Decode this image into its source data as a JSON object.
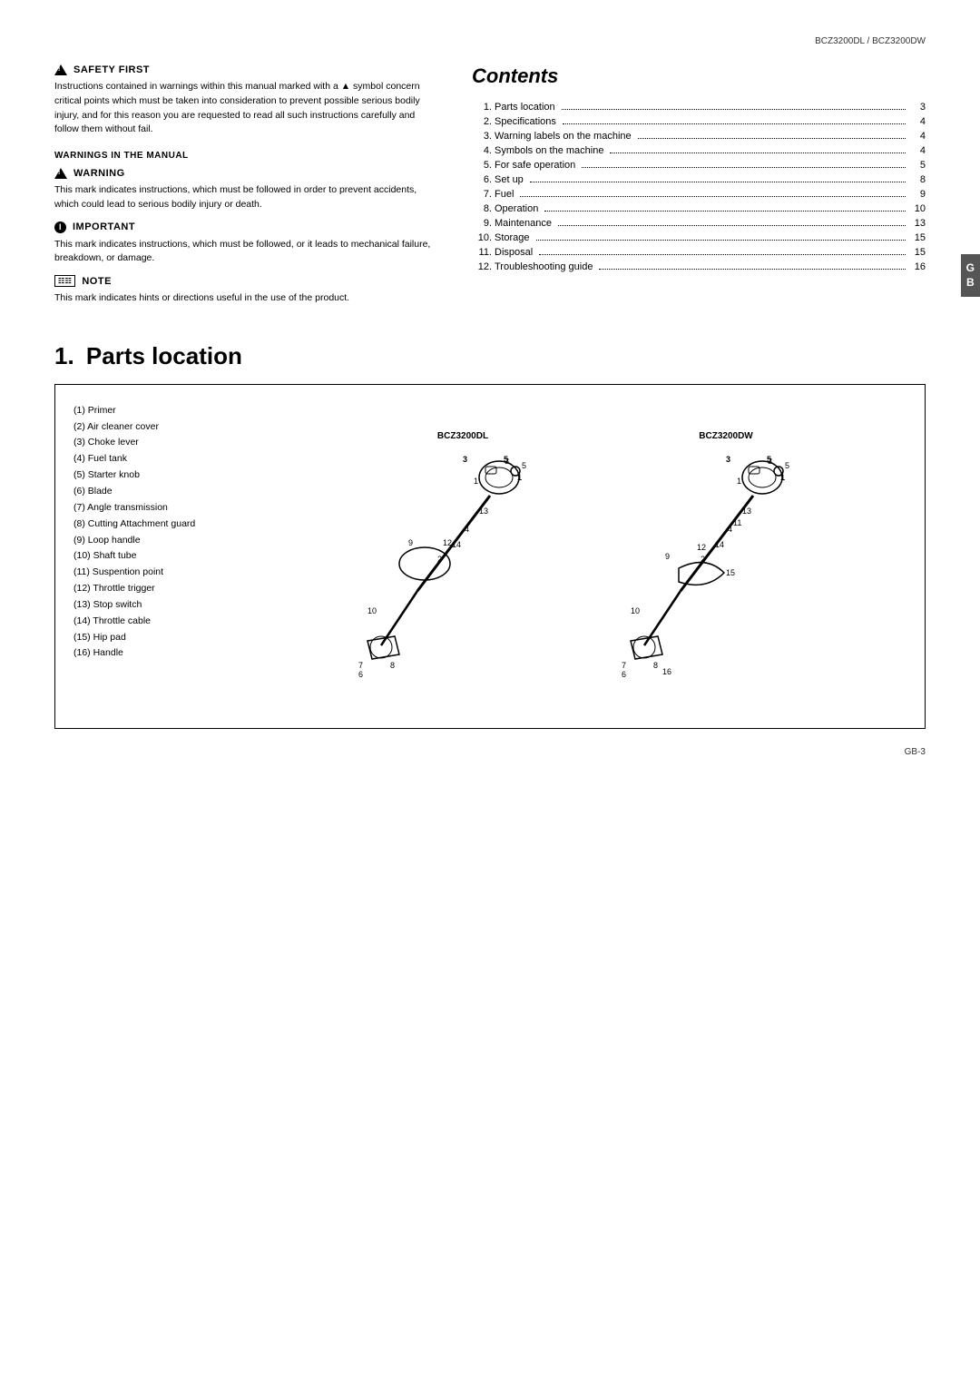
{
  "header": {
    "model": "BCZ3200DL / BCZ3200DW"
  },
  "left_column": {
    "safety_first": {
      "title": "SAFETY FIRST",
      "body": "Instructions contained in warnings within this manual marked with a ▲ symbol concern critical points which must be taken into consideration to prevent possible serious bodily injury, and for this reason you are requested to read all such instructions carefully and follow them without fail."
    },
    "warnings_manual": {
      "title": "WARNINGS IN THE MANUAL"
    },
    "warning": {
      "title": "WARNING",
      "body": "This mark indicates instructions, which must be followed in order to prevent accidents, which could lead to serious bodily injury or death."
    },
    "important": {
      "title": "IMPORTANT",
      "body": "This mark indicates instructions, which must be followed, or it leads to mechanical failure, breakdown, or damage."
    },
    "note": {
      "title": "NOTE",
      "body": "This mark indicates hints or directions useful in the use of the product."
    }
  },
  "contents": {
    "title": "Contents",
    "items": [
      {
        "number": "1.",
        "label": "Parts location",
        "dots": true,
        "page": "3"
      },
      {
        "number": "2.",
        "label": "Specifications",
        "dots": true,
        "page": "4"
      },
      {
        "number": "3.",
        "label": "Warning labels on the machine",
        "dots": true,
        "page": "4"
      },
      {
        "number": "4.",
        "label": "Symbols on the machine",
        "dots": true,
        "page": "4"
      },
      {
        "number": "5.",
        "label": "For safe operation",
        "dots": true,
        "page": "5"
      },
      {
        "number": "6.",
        "label": "Set up",
        "dots": true,
        "page": "8"
      },
      {
        "number": "7.",
        "label": "Fuel",
        "dots": true,
        "page": "9"
      },
      {
        "number": "8.",
        "label": "Operation",
        "dots": true,
        "page": "10"
      },
      {
        "number": "9.",
        "label": "Maintenance",
        "dots": true,
        "page": "13"
      },
      {
        "number": "10.",
        "label": "Storage",
        "dots": true,
        "page": "15"
      },
      {
        "number": "11.",
        "label": "Disposal",
        "dots": true,
        "page": "15"
      },
      {
        "number": "12.",
        "label": "Troubleshooting guide",
        "dots": true,
        "page": "16"
      }
    ]
  },
  "gb_tab": {
    "text": "G\nB"
  },
  "parts_location": {
    "title_number": "1.",
    "title": "Parts location",
    "parts_list": [
      "(1)  Primer",
      "(2)  Air cleaner cover",
      "(3)  Choke lever",
      "(4)  Fuel tank",
      "(5)  Starter knob",
      "(6)  Blade",
      "(7)  Angle transmission",
      "(8)  Cutting Attachment guard",
      "(9)  Loop handle",
      "(10) Shaft tube",
      "(11) Suspention point",
      "(12) Throttle trigger",
      "(13) Stop switch",
      "(14) Throttle cable",
      "(15) Hip pad",
      "(16) Handle"
    ],
    "diagram1": {
      "label": "BCZ3200DL"
    },
    "diagram2": {
      "label": "BCZ3200DW"
    }
  },
  "footer": {
    "page": "GB-3"
  }
}
